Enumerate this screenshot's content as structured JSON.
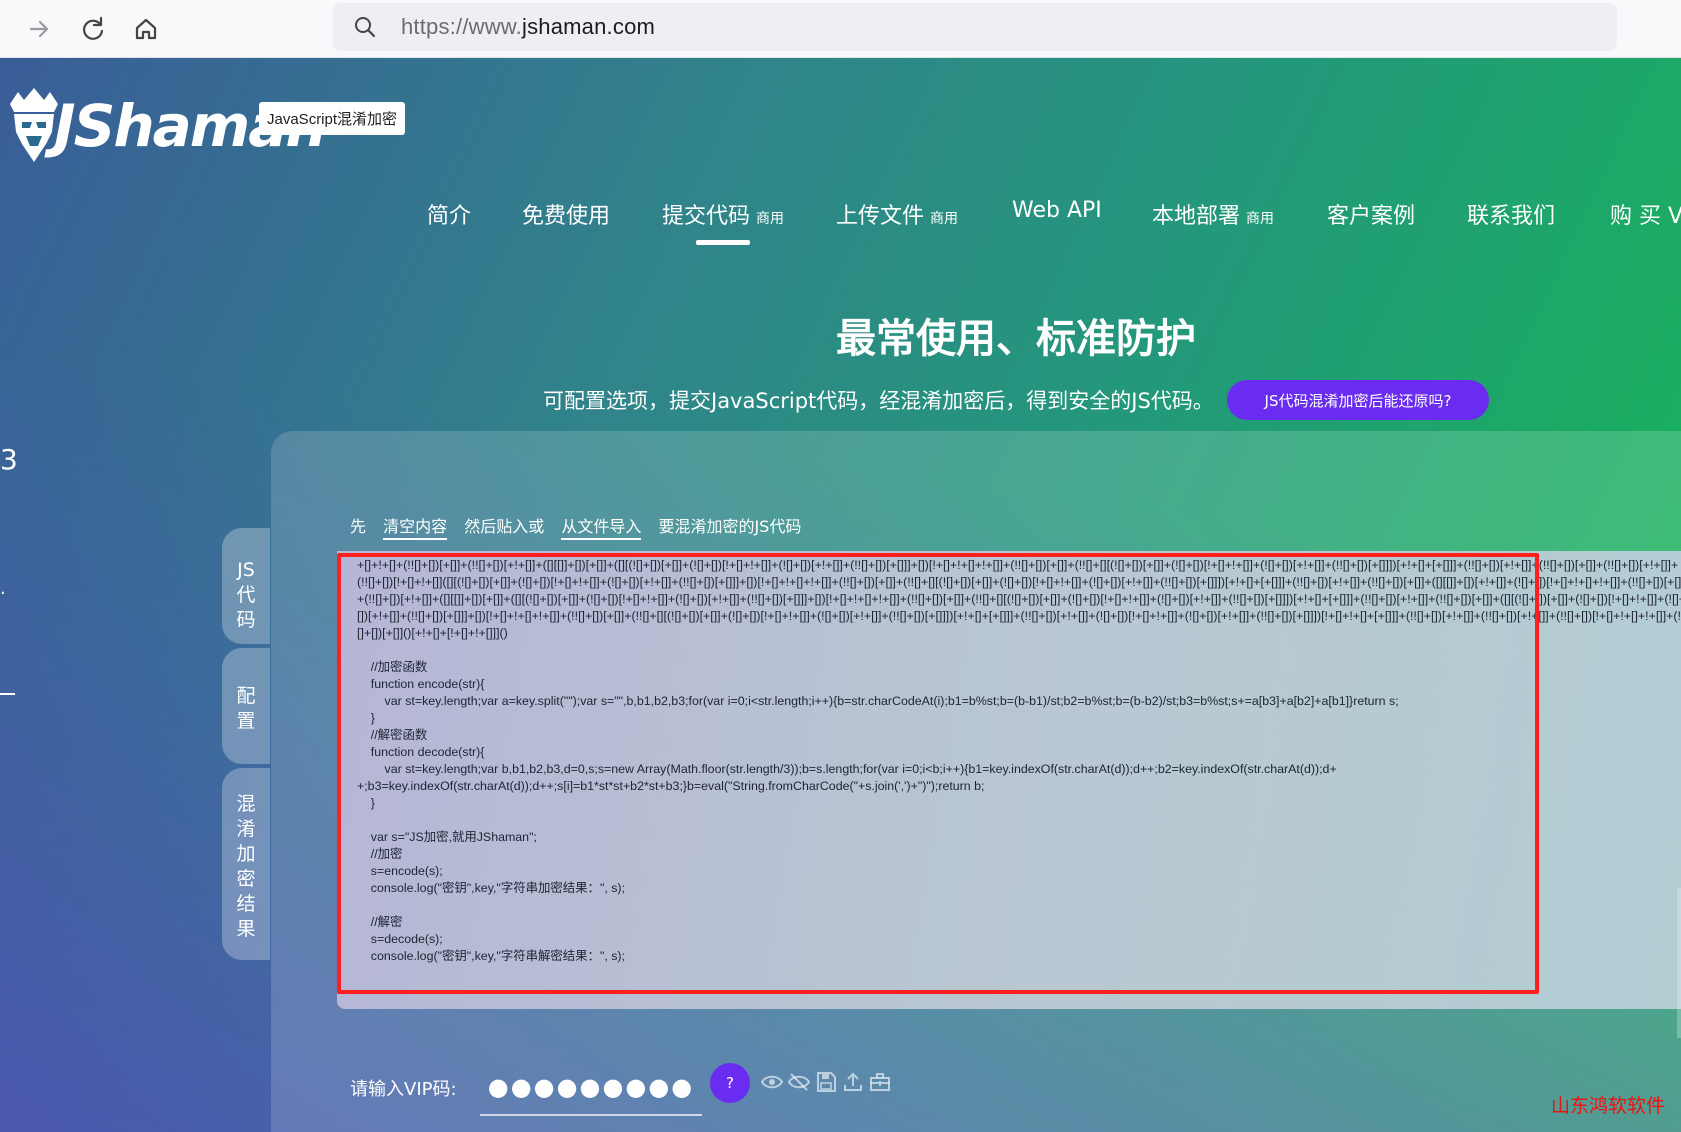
{
  "browser": {
    "url_prefix": "https://www.",
    "url_host": "jshaman.com",
    "back_icon": "back-arrow-icon",
    "reload_icon": "reload-icon",
    "home_icon": "home-icon"
  },
  "site": {
    "logo_text": "JShaman",
    "tagline": "JavaScript混淆加密"
  },
  "nav": {
    "items": [
      {
        "label": "简介",
        "tag": ""
      },
      {
        "label": "免费使用",
        "tag": ""
      },
      {
        "label": "提交代码",
        "tag": "商用"
      },
      {
        "label": "上传文件",
        "tag": "商用"
      },
      {
        "label": "Web API",
        "tag": ""
      },
      {
        "label": "本地部署",
        "tag": "商用"
      },
      {
        "label": "客户案例",
        "tag": ""
      },
      {
        "label": "联系我们",
        "tag": ""
      },
      {
        "label": "购 买 V",
        "tag": ""
      }
    ],
    "active_index": 2
  },
  "hero": {
    "title": "最常使用、标准防护",
    "subtitle": "可配置选项，提交JavaScript代码，经混淆加密后，得到安全的JS代码。",
    "button_label": "JS代码混淆加密后能还原吗?"
  },
  "left_edge": {
    "digit": "3",
    "dot": "."
  },
  "side_tabs": [
    {
      "chars": [
        "JS",
        "代",
        "码"
      ]
    },
    {
      "chars": [
        "配",
        "置"
      ]
    },
    {
      "chars": [
        "混",
        "淆",
        "加",
        "密",
        "结",
        "果"
      ]
    }
  ],
  "instruction": {
    "prefix": "先",
    "clear_link": "清空内容",
    "middle": "然后贴入或",
    "import_link": "从文件导入",
    "suffix": "要混淆加密的JS代码"
  },
  "code": {
    "text": "+[]+!+[]+(!![]+[])[+[]]+(!![]+[])[+!+[]]+([][[]]+[])[+[]]+([][(![]+[])[+[]]+(![]+[])[!+[]+!+[]]+(![]+[])[+!+[]]+(!![]+[])[+[]]]+[])[!+[]+!+[]+!+[]]+(!![]+[])[+[]]+(!![]+[][(![]+[])[+[]]+(![]+[])[!+[]+!+[]]+(![]+[])[+!+[]]+(!![]+[])[+[]]])[+!+[]+[+[]]]+(!![]+[])[+!+[]]+(!![]+[])[+[]]+(!![]+[])[+!+[]]+(!![]+[])[!+[]+!+[]]([][(![]+[])[+[]]+(![]+[])[!+[]+!+[]]+(![]+[])[+!+[]]+(!![]+[])[+[]]]+[])[!+[]+!+[]+!+[]]+(!![]+[])[+[]]+(!![]+[][(![]+[])[+[]]+(![]+[])[!+[]+!+[]]+(![]+[])[+!+[]]+(!![]+[])[+[]]])[+!+[]+[+[]]]+(!![]+[])[+!+[]]+(!![]+[])[+[]]+([][[]]+[])[+!+[]]+(![]+[])[!+[]+!+[]+!+[]]+(!![]+[])[+[]]+(!![]+[])[+!+[]]+([][[]]+[])[+[]]+([][(![]+[])[+[]]+(![]+[])[!+[]+!+[]]+(![]+[])[+!+[]]+(!![]+[])[+[]]]+[])[!+[]+!+[]+!+[]]+(!![]+[])[+[]]+(!![]+[][(![]+[])[+[]]+(![]+[])[!+[]+!+[]]+(![]+[])[+!+[]]+(!![]+[])[+[]]])[+!+[]+[+[]]]+(!![]+[])[+!+[]]+(!![]+[])[+[]]+([][(![]+[])[+[]]+(![]+[])[!+[]+!+[]]+(![]+[])[+!+[]]+(!![]+[])[+[]]]+[])[!+[]+!+[]+!+[]]+(!![]+[])[+[]]+(!![]+[][(![]+[])[+[]]+(![]+[])[!+[]+!+[]]+(![]+[])[+!+[]]+(!![]+[])[+[]]])[+!+[]+[+[]]]+(!![]+[])[+!+[]]+(![]+[])[!+[]+!+[]]+(![]+[])[+!+[]]+(!![]+[])[+[]]])[!+[]+!+[]+[+[]]]+(!![]+[])[+!+[]]+(!![]+[])[+!+[]]+(!![]+[])[!+[]+!+[]+!+[]]+(!![]+[])[+[]]()[+!+[]+[!+[]+!+[]]]()\n\n    //加密函数\n    function encode(str){\n        var st=key.length;var a=key.split(\"\");var s=\"\",b,b1,b2,b3;for(var i=0;i<str.length;i++){b=str.charCodeAt(i);b1=b%st;b=(b-b1)/st;b2=b%st;b=(b-b2)/st;b3=b%st;s+=a[b3]+a[b2]+a[b1]}return s;\n    }\n    //解密函数\n    function decode(str){\n        var st=key.length;var b,b1,b2,b3,d=0,s;s=new Array(Math.floor(str.length/3));b=s.length;for(var i=0;i<b;i++){b1=key.indexOf(str.charAt(d));d++;b2=key.indexOf(str.charAt(d));d+\n+;b3=key.indexOf(str.charAt(d));d++;s[i]=b1*st*st+b2*st+b3;}b=eval(\"String.fromCharCode(\"+s.join(',')+\")\");return b;\n    }\n\n    var s=\"JS加密,就用JShaman\";\n    //加密\n    s=encode(s);\n    console.log(\"密钥\",key,\"字符串加密结果：\", s);\n\n    //解密\n    s=decode(s);\n    console.log(\"密钥\",key,\"字符串解密结果：\", s);"
  },
  "vip": {
    "label": "请输入VIP码:",
    "value": "●●●●●●●●●",
    "help_label": "?"
  },
  "tools": [
    "eye-icon",
    "eye-off-icon",
    "save-icon",
    "upload-icon",
    "toolbox-icon"
  ],
  "watermark": "山东鸿软软件"
}
